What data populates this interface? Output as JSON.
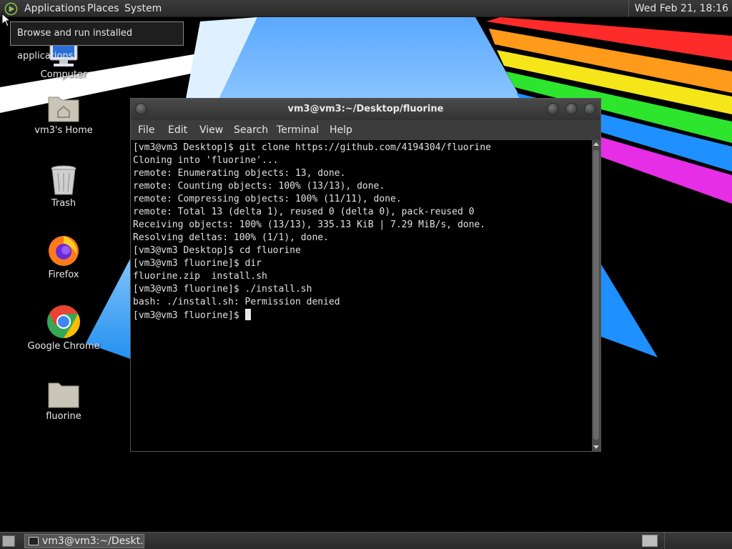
{
  "top_panel": {
    "menus": [
      "Applications",
      "Places",
      "System"
    ],
    "clock": "Wed Feb 21, 18:16"
  },
  "tooltip": {
    "text": "Browse and run installed applications"
  },
  "desktop_icons": [
    {
      "label": "Computer",
      "icon": "computer-icon"
    },
    {
      "label": "vm3's Home",
      "icon": "home-folder-icon"
    },
    {
      "label": "Trash",
      "icon": "trash-icon"
    },
    {
      "label": "Firefox",
      "icon": "firefox-icon"
    },
    {
      "label": "Google Chrome",
      "icon": "chrome-icon"
    },
    {
      "label": "fluorine",
      "icon": "folder-icon"
    }
  ],
  "terminal": {
    "title": "vm3@vm3:~/Desktop/fluorine",
    "menus": [
      "File",
      "Edit",
      "View",
      "Search",
      "Terminal",
      "Help"
    ],
    "lines": [
      "[vm3@vm3 Desktop]$ git clone https://github.com/4194304/fluorine",
      "Cloning into 'fluorine'...",
      "remote: Enumerating objects: 13, done.",
      "remote: Counting objects: 100% (13/13), done.",
      "remote: Compressing objects: 100% (11/11), done.",
      "remote: Total 13 (delta 1), reused 0 (delta 0), pack-reused 0",
      "Receiving objects: 100% (13/13), 335.13 KiB | 7.29 MiB/s, done.",
      "Resolving deltas: 100% (1/1), done.",
      "[vm3@vm3 Desktop]$ cd fluorine",
      "[vm3@vm3 fluorine]$ dir",
      "fluorine.zip  install.sh",
      "[vm3@vm3 fluorine]$ ./install.sh",
      "bash: ./install.sh: Permission denied",
      "[vm3@vm3 fluorine]$ "
    ]
  },
  "taskbar": {
    "task_label": "vm3@vm3:~/Deskt..."
  },
  "colors": {
    "panel": "#2f2f2f",
    "terminal_bg": "#000000",
    "terminal_fg": "#e0e0e0"
  }
}
